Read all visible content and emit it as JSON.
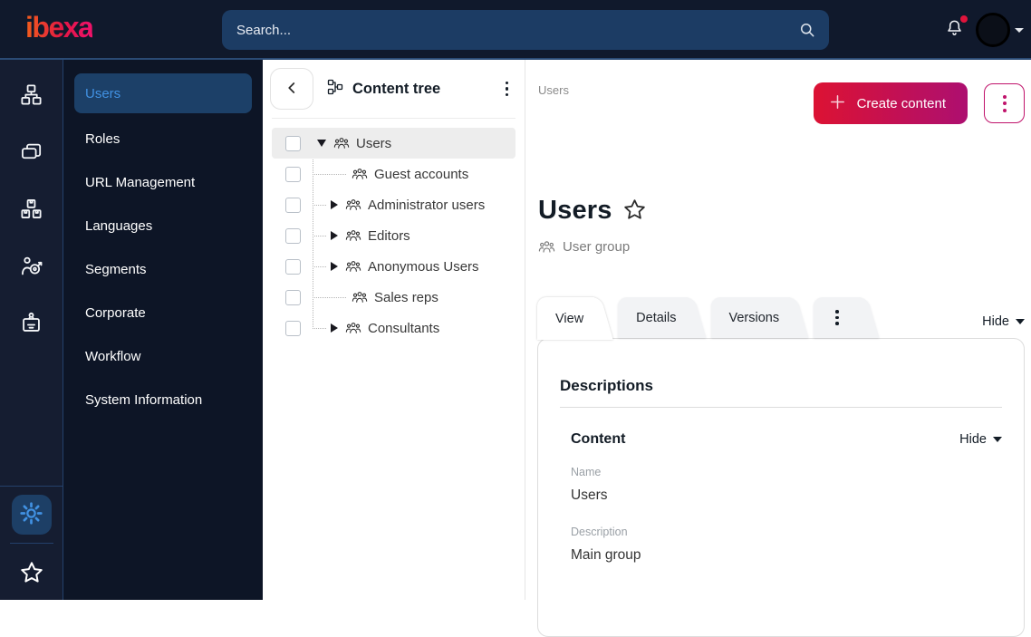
{
  "brand": {
    "logo_text": "ibexa"
  },
  "topbar": {
    "search_placeholder": "Search..."
  },
  "icon_rail": {
    "items": [
      {
        "name": "content-structure"
      },
      {
        "name": "content-types"
      },
      {
        "name": "product-catalog"
      },
      {
        "name": "personalization"
      },
      {
        "name": "corporate-accounts"
      }
    ],
    "bottom": [
      {
        "name": "settings",
        "active": true
      },
      {
        "name": "bookmarks"
      }
    ]
  },
  "sidebar": {
    "items": [
      {
        "label": "Users",
        "active": true
      },
      {
        "label": "Roles"
      },
      {
        "label": "URL Management"
      },
      {
        "label": "Languages"
      },
      {
        "label": "Segments"
      },
      {
        "label": "Corporate"
      },
      {
        "label": "Workflow"
      },
      {
        "label": "System Information"
      }
    ]
  },
  "content_tree": {
    "title": "Content tree",
    "items": [
      {
        "label": "Users",
        "depth": 0,
        "expander": "expanded",
        "selected": true
      },
      {
        "label": "Guest accounts",
        "depth": 1,
        "expander": "none"
      },
      {
        "label": "Administrator users",
        "depth": 1,
        "expander": "collapsed"
      },
      {
        "label": "Editors",
        "depth": 1,
        "expander": "collapsed"
      },
      {
        "label": "Anonymous Users",
        "depth": 1,
        "expander": "collapsed"
      },
      {
        "label": "Sales reps",
        "depth": 1,
        "expander": "none"
      },
      {
        "label": "Consultants",
        "depth": 1,
        "expander": "collapsed"
      }
    ]
  },
  "main": {
    "breadcrumb": "Users",
    "create_button_label": "Create content",
    "page_title": "Users",
    "content_type_label": "User group",
    "tabs": [
      {
        "label": "View",
        "active": true
      },
      {
        "label": "Details",
        "active": false
      },
      {
        "label": "Versions",
        "active": false
      }
    ],
    "collapse_label": "Hide",
    "card": {
      "section_title": "Descriptions",
      "group_title": "Content",
      "collapse_label": "Hide",
      "fields": [
        {
          "label": "Name",
          "value": "Users"
        },
        {
          "label": "Description",
          "value": "Main group"
        }
      ]
    }
  },
  "colors": {
    "topbar_bg": "#10192c",
    "rail_bg": "#151d31",
    "sidebar_bg": "#0d1526",
    "accent_magenta": "#c0136b",
    "button_gradient_start": "#dc1233",
    "button_gradient_end": "#ad0f70",
    "selected_blue": "#4191e2",
    "selected_pill_bg": "#1c4068",
    "search_bg": "#1c3c64",
    "notification_red": "#e0143c"
  }
}
